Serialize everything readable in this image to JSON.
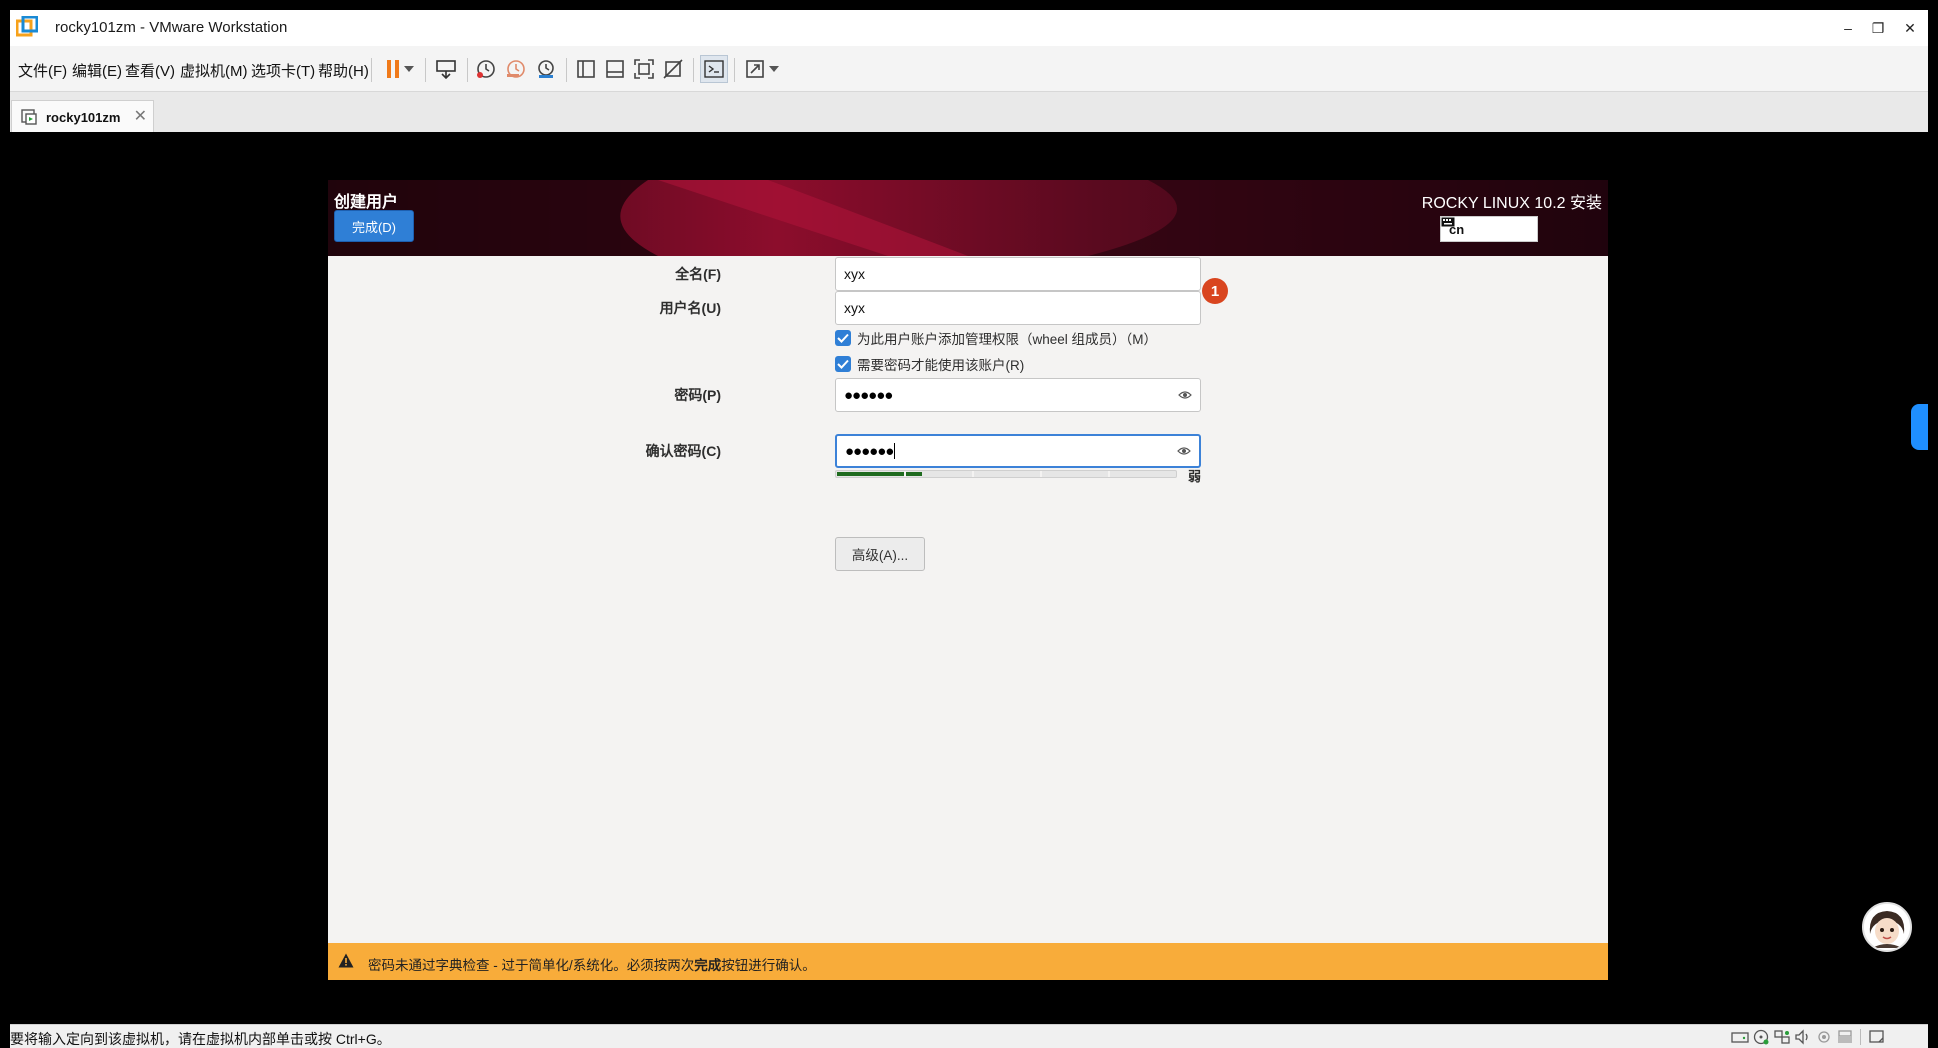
{
  "window": {
    "title": "rocky101zm - VMware Workstation",
    "minimize": "–",
    "restore": "❐",
    "close": "✕"
  },
  "menu": {
    "items": [
      "文件(F)",
      "编辑(E)",
      "查看(V)",
      "虚拟机(M)",
      "选项卡(T)",
      "帮助(H)"
    ]
  },
  "toolbar": {
    "icons": [
      "pause-icon",
      "send-ctrl-alt-del-icon",
      "snapshot-icon",
      "revert-snapshot-icon",
      "snapshot-manager-icon",
      "show-library-icon",
      "thumbnail-bar-icon",
      "fit-guest-icon",
      "full-screen-icon",
      "console-view-icon",
      "unity-icon"
    ]
  },
  "tab": {
    "label": "rocky101zm",
    "close": "✕"
  },
  "installer": {
    "page_title": "创建用户",
    "done_button": "完成(D)",
    "product_title": "ROCKY LINUX 10.2 安装",
    "keyboard_layout": "cn",
    "fullname_label": "全名(F)",
    "fullname_value": "xyx",
    "error_badge": "1",
    "username_label": "用户名(U)",
    "username_value": "xyx",
    "admin_checkbox_label": "为此用户账户添加管理权限（wheel 组成员）（M）",
    "admin_checked": true,
    "require_password_label": "需要密码才能使用该账户(R)",
    "require_password_checked": true,
    "password_label": "密码(P)",
    "password_value": "●●●●●●",
    "password_strength": 0.25,
    "password_strength_label": "弱",
    "confirm_label": "确认密码(C)",
    "confirm_value": "●●●●●●",
    "advanced_button": "高级(A)...",
    "warning_prefix": "密码未通过字典检查 - 过于简单化/系统化。必须按两次",
    "warning_bold": "完成",
    "warning_suffix": "按钮进行确认。"
  },
  "status": {
    "text": "要将输入定向到该虚拟机，请在虚拟机内部单击或按 Ctrl+G。"
  },
  "colors": {
    "accent": "#2f7fd6",
    "warning": "#f8ac3a",
    "error": "#d9451f",
    "banner": "#7a0a26"
  }
}
